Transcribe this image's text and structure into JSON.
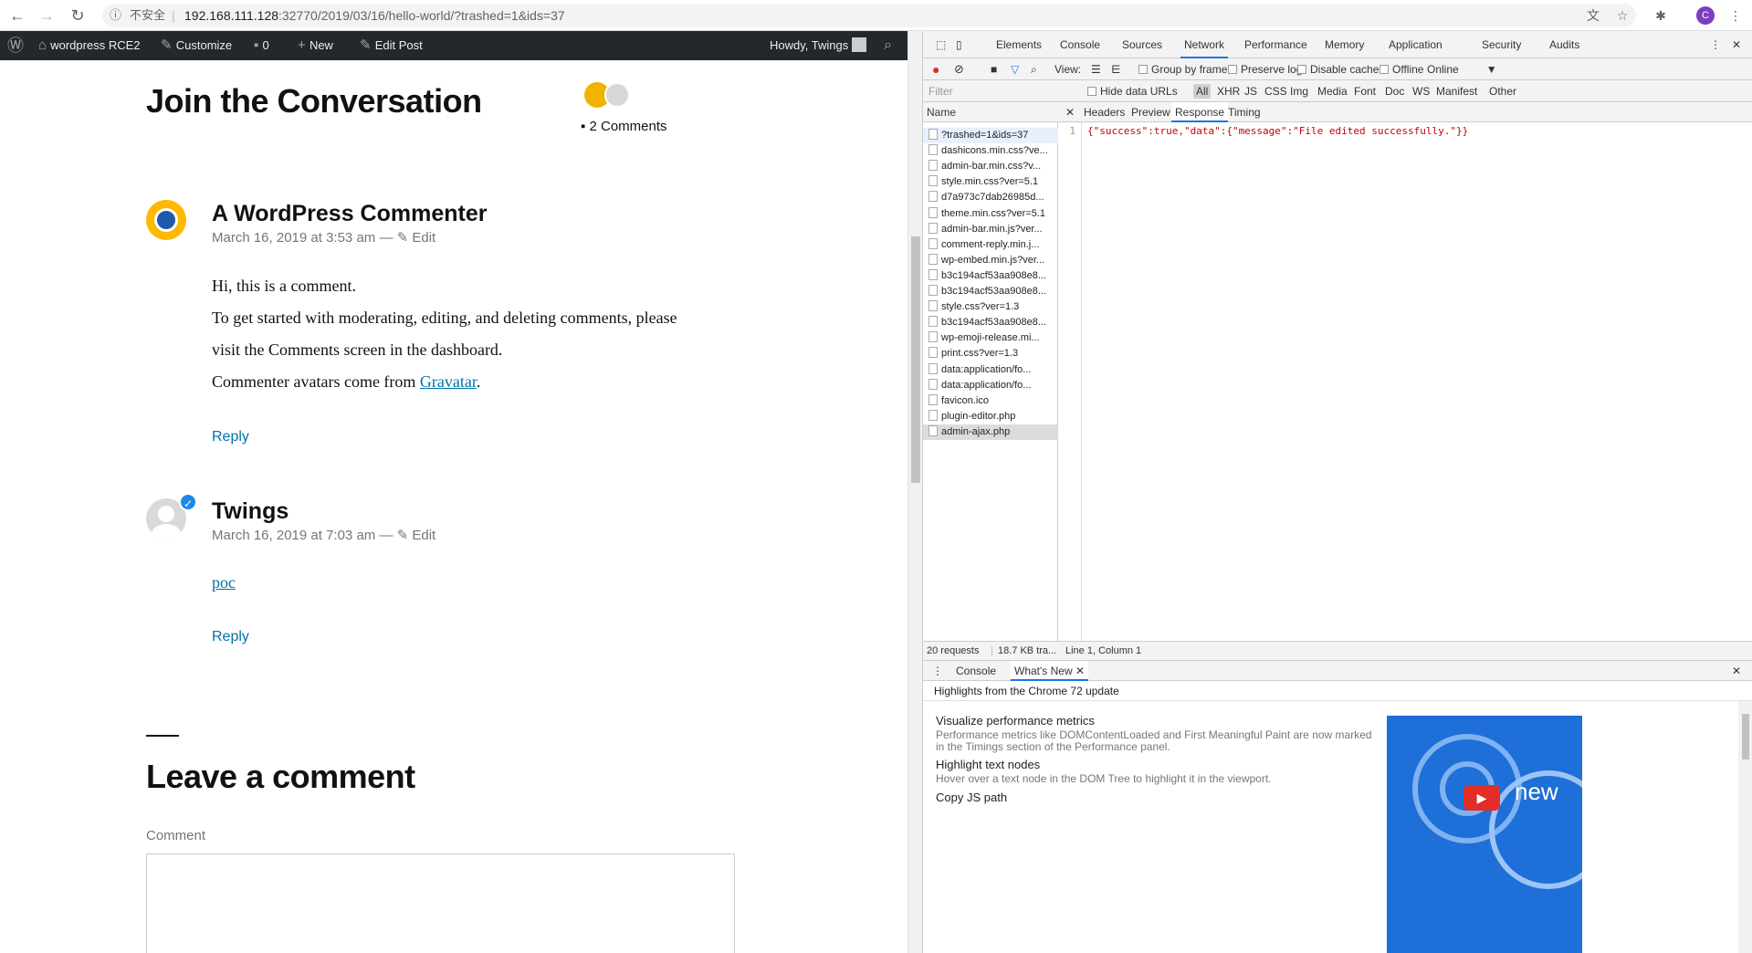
{
  "browser": {
    "insecure_label": "不安全",
    "url_host": "192.168.111.128",
    "url_path": ":32770/2019/03/16/hello-world/?trashed=1&ids=37",
    "profile_initial": "C"
  },
  "adminbar": {
    "site": "wordpress RCE2",
    "customize": "Customize",
    "comments_count": "0",
    "new": "New",
    "edit_post": "Edit Post",
    "howdy": "Howdy, Twings"
  },
  "article": {
    "conversation_title": "Join the Conversation",
    "comments_link": "2 Comments",
    "comments": [
      {
        "author": "A WordPress Commenter",
        "date": "March 16, 2019 at 3:53 am",
        "edit": "Edit",
        "lines": [
          "Hi, this is a comment.",
          "To get started with moderating, editing, and deleting comments, please",
          "visit the Comments screen in the dashboard.",
          "Commenter avatars come from "
        ],
        "link_text": "Gravatar",
        "link_suffix": ".",
        "reply": "Reply"
      },
      {
        "author": "Twings",
        "date": "March 16, 2019 at 7:03 am",
        "edit": "Edit",
        "link_text": "poc",
        "reply": "Reply"
      }
    ],
    "leave_title": "Leave a comment",
    "comment_label": "Comment",
    "meta_separator": "—"
  },
  "devtools": {
    "tabs": [
      "Elements",
      "Console",
      "Sources",
      "Network",
      "Performance",
      "Memory",
      "Application",
      "Security",
      "Audits"
    ],
    "active_tab": "Network",
    "toolbar": {
      "view_label": "View:",
      "group_by_frame": "Group by frame",
      "preserve_log": "Preserve log",
      "disable_cache": "Disable cache",
      "offline": "Offline",
      "throttle": "Online"
    },
    "filter": {
      "placeholder": "Filter",
      "hide_data_urls": "Hide data URLs",
      "types": [
        "All",
        "XHR",
        "JS",
        "CSS",
        "Img",
        "Media",
        "Font",
        "Doc",
        "WS",
        "Manifest",
        "Other"
      ]
    },
    "list_header": "Name",
    "requests": [
      "?trashed=1&ids=37",
      "dashicons.min.css?ve...",
      "admin-bar.min.css?v...",
      "style.min.css?ver=5.1",
      "d7a973c7dab26985d...",
      "theme.min.css?ver=5.1",
      "admin-bar.min.js?ver...",
      "comment-reply.min.j...",
      "wp-embed.min.js?ver...",
      "b3c194acf53aa908e8...",
      "b3c194acf53aa908e8...",
      "style.css?ver=1.3",
      "b3c194acf53aa908e8...",
      "wp-emoji-release.mi...",
      "print.css?ver=1.3",
      "data:application/fo...",
      "data:application/fo...",
      "favicon.ico",
      "plugin-editor.php",
      "admin-ajax.php"
    ],
    "detail_tabs": [
      "Headers",
      "Preview",
      "Response",
      "Timing"
    ],
    "active_detail_tab": "Response",
    "response_line_no": "1",
    "response_body": "{\"success\":true,\"data\":{\"message\":\"File edited successfully.\"}}",
    "status_requests": "20 requests",
    "status_transfer": "18.7 KB tra...",
    "status_position": "Line 1, Column 1",
    "drawer_tabs": [
      "Console",
      "What's New"
    ],
    "drawer_active": "What's New",
    "drawer_subtitle": "Highlights from the Chrome 72 update",
    "whats_new": [
      {
        "title": "Visualize performance metrics",
        "desc": "Performance metrics like DOMContentLoaded and First Meaningful Paint are now marked in the Timings section of the Performance panel."
      },
      {
        "title": "Highlight text nodes",
        "desc": "Hover over a text node in the DOM Tree to highlight it in the viewport."
      },
      {
        "title": "Copy JS path",
        "desc": ""
      }
    ],
    "promo_text": "new"
  }
}
